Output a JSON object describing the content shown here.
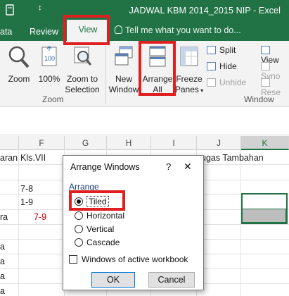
{
  "window": {
    "title": "JADWAL KBM 2014_2015 NIP - Excel",
    "qa_caret": "↕"
  },
  "tabs": {
    "data": "ata",
    "review": "Review",
    "view": "View",
    "tellme": "Tell me what you want to do..."
  },
  "ribbon": {
    "zoom": "Zoom",
    "zoom100": "100%",
    "zoom_selection_1": "Zoom to",
    "zoom_selection_2": "Selection",
    "zoom_group": "Zoom",
    "new_window_1": "New",
    "new_window_2": "Window",
    "arrange_all_1": "Arrange",
    "arrange_all_2": "All",
    "freeze_1": "Freeze",
    "freeze_2": "Panes",
    "split": "Split",
    "hide": "Hide",
    "unhide": "Unhide",
    "view_side": "View",
    "sync": "Syno",
    "reset": "Rese",
    "window_group": "Window"
  },
  "columns": {
    "f": "F",
    "g": "G",
    "h": "H",
    "i": "I",
    "j": "J",
    "k": "K"
  },
  "grid": {
    "header_left": "aran",
    "header_f": "Kls.VII",
    "header_j": "ugas Tambahan",
    "r1_f": "7-8",
    "r2_f": "1-9",
    "r3_left": "ra",
    "r3_f": "7-9",
    "r4_left": "a",
    "r5_left": "a",
    "r6_left": "a",
    "r7_left": "a",
    "r8_left": "a"
  },
  "dialog": {
    "title": "Arrange Windows",
    "help": "?",
    "close": "✕",
    "group": "Arrange",
    "options": [
      "Tiled",
      "Horizontal",
      "Vertical",
      "Cascade"
    ],
    "selected": "Tiled",
    "checkbox": "Windows of active workbook",
    "ok": "OK",
    "cancel": "Cancel"
  },
  "colors": {
    "excel_green": "#217346",
    "highlight_red": "#e02020",
    "value_red": "#c00000"
  }
}
